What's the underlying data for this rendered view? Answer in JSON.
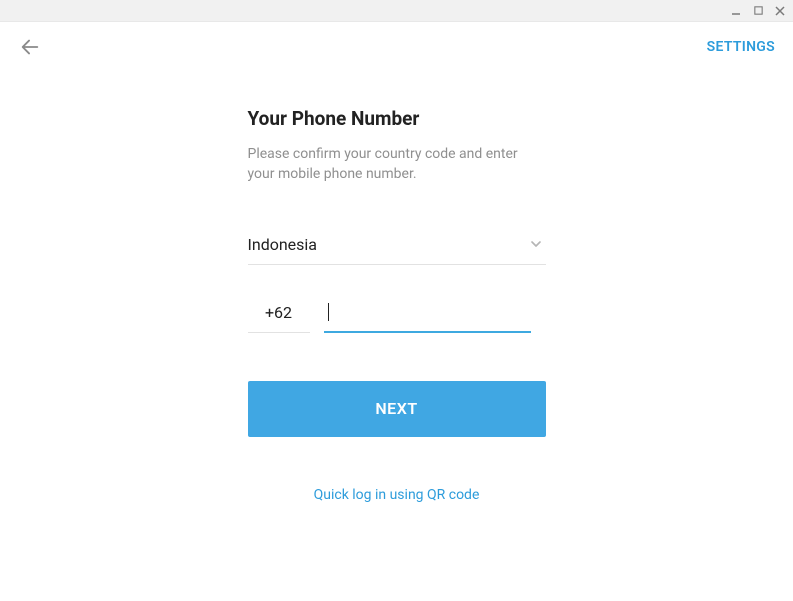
{
  "window": {},
  "topbar": {
    "settings_label": "SETTINGS"
  },
  "heading": {
    "title": "Your Phone Number",
    "subtitle": "Please confirm your country code and enter your mobile phone number."
  },
  "form": {
    "country": "Indonesia",
    "country_code": "+62",
    "phone_value": "",
    "next_label": "NEXT"
  },
  "qr": {
    "link_label": "Quick log in using QR code"
  },
  "colors": {
    "accent": "#40a7e3",
    "link": "#2d9cdb"
  }
}
